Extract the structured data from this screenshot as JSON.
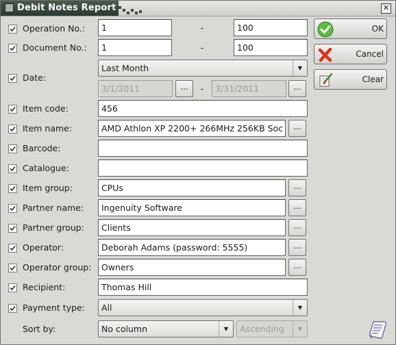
{
  "window": {
    "title": "Debit Notes Report",
    "close_glyph": "✕"
  },
  "filters": {
    "operation_no": {
      "label": "Operation No.:",
      "from": "1",
      "separator": "-",
      "to": "100"
    },
    "document_no": {
      "label": "Document No.:",
      "from": "1",
      "separator": "-",
      "to": "100"
    },
    "date": {
      "label": "Date:",
      "period": "Last Month",
      "from": "3/1/2011",
      "separator": "-",
      "to": "3/31/2011",
      "picker_label": "..."
    },
    "item_code": {
      "label": "Item code:",
      "value": "456"
    },
    "item_name": {
      "label": "Item name:",
      "value": "AMD Athlon XP 2200+ 266MHz 256KB Soc",
      "picker_label": "..."
    },
    "barcode": {
      "label": "Barcode:",
      "value": ""
    },
    "catalogue": {
      "label": "Catalogue:",
      "value": ""
    },
    "item_group": {
      "label": "Item group:",
      "value": "CPUs",
      "picker_label": "..."
    },
    "partner_name": {
      "label": "Partner name:",
      "value": "Ingenuity Software",
      "picker_label": "..."
    },
    "partner_group": {
      "label": "Partner group:",
      "value": "Clients",
      "picker_label": "..."
    },
    "operator": {
      "label": "Operator:",
      "value": "Deborah Adams (password: 5555)",
      "picker_label": "..."
    },
    "operator_group": {
      "label": "Operator group:",
      "value": "Owners",
      "picker_label": "..."
    },
    "recipient": {
      "label": "Recipient:",
      "value": "Thomas Hill"
    },
    "payment_type": {
      "label": "Payment type:",
      "value": "All"
    }
  },
  "sort": {
    "label": "Sort by:",
    "column": "No column",
    "direction": "Ascending"
  },
  "buttons": {
    "ok": "OK",
    "cancel": "Cancel",
    "clear": "Clear"
  },
  "icons": {
    "ok": "check-circle-icon",
    "cancel": "red-x-icon",
    "clear": "eraser-icon",
    "corner": "scroll-report-icon"
  },
  "colors": {
    "title_bar": "#34433a",
    "ok_green": "#4caf3a",
    "cancel_red": "#d8321c"
  }
}
